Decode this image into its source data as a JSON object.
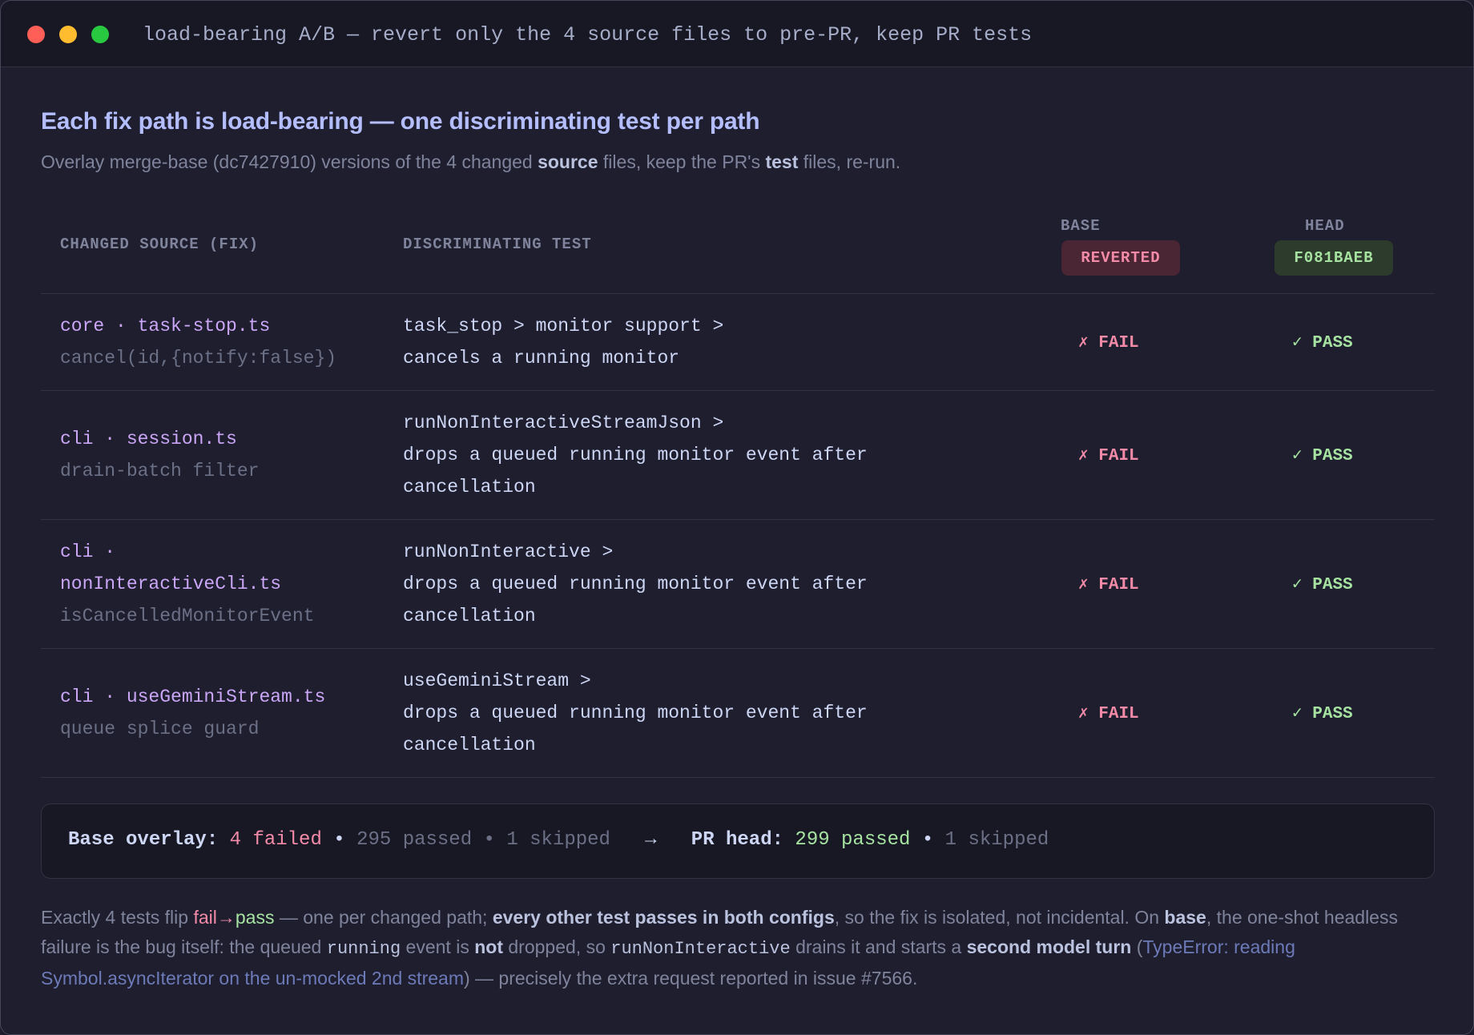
{
  "window": {
    "title": "load-bearing A/B — revert only the 4 source files to pre-PR, keep PR tests"
  },
  "heading": "Each fix path is load-bearing — one discriminating test per path",
  "subheading": {
    "prefix": "Overlay merge-base (dc7427910) versions of the 4 changed ",
    "bold1": "source",
    "middle": " files, keep the PR's ",
    "bold2": "test",
    "suffix": " files, re-run."
  },
  "table": {
    "headers": {
      "source": "CHANGED SOURCE (FIX)",
      "test": "DISCRIMINATING TEST",
      "base": "BASE",
      "base_badge": "REVERTED",
      "head": "HEAD",
      "head_badge": "F081BAEB"
    },
    "rows": [
      {
        "source_lines": [
          "core · task-stop.ts"
        ],
        "detail_lines": [
          "cancel(id,{notify:false})"
        ],
        "test_lines": [
          "task_stop > monitor support >",
          "cancels a running monitor"
        ],
        "base": "✗ FAIL",
        "head": "✓ PASS"
      },
      {
        "source_lines": [
          "cli · session.ts"
        ],
        "detail_lines": [
          "drain-batch filter"
        ],
        "test_lines": [
          "runNonInteractiveStreamJson >",
          "drops a queued running monitor event after",
          "cancellation"
        ],
        "base": "✗ FAIL",
        "head": "✓ PASS"
      },
      {
        "source_lines": [
          "cli ·",
          "nonInteractiveCli.ts"
        ],
        "detail_lines": [
          "isCancelledMonitorEvent"
        ],
        "test_lines": [
          "runNonInteractive >",
          "drops a queued running monitor event after",
          "cancellation"
        ],
        "base": "✗ FAIL",
        "head": "✓ PASS"
      },
      {
        "source_lines": [
          "cli · useGeminiStream.ts"
        ],
        "detail_lines": [
          "queue splice guard"
        ],
        "test_lines": [
          "useGeminiStream >",
          "drops a queued running monitor event after",
          "cancellation"
        ],
        "base": "✗ FAIL",
        "head": "✓ PASS"
      }
    ]
  },
  "summary": {
    "base_label": "Base overlay:",
    "base_failed": "4 failed",
    "sep": "•",
    "base_passed": "295 passed",
    "base_skipped": "1 skipped",
    "arrow": "→",
    "head_label": "PR head:",
    "head_passed": "299 passed",
    "head_skipped": "1 skipped"
  },
  "footer": {
    "t1": "Exactly 4 tests flip ",
    "fail": "fail",
    "arrow": "→",
    "pass": "pass",
    "t2": " — one per changed path; ",
    "b1": "every other test passes in both configs",
    "t3": ", so the fix is isolated, not incidental. On ",
    "b2": "base",
    "t4": ", the one-shot headless failure is the bug itself: the queued ",
    "c1": "running",
    "t5": " event is ",
    "b3": "not",
    "t6": " dropped, so ",
    "c2": "runNonInteractive",
    "t7": " drains it and starts a ",
    "b4": "second model turn",
    "t8": " (",
    "err": "TypeError: reading Symbol.asyncIterator on the un-mocked 2nd stream",
    "t9": ") — precisely the extra request reported in issue #7566."
  }
}
